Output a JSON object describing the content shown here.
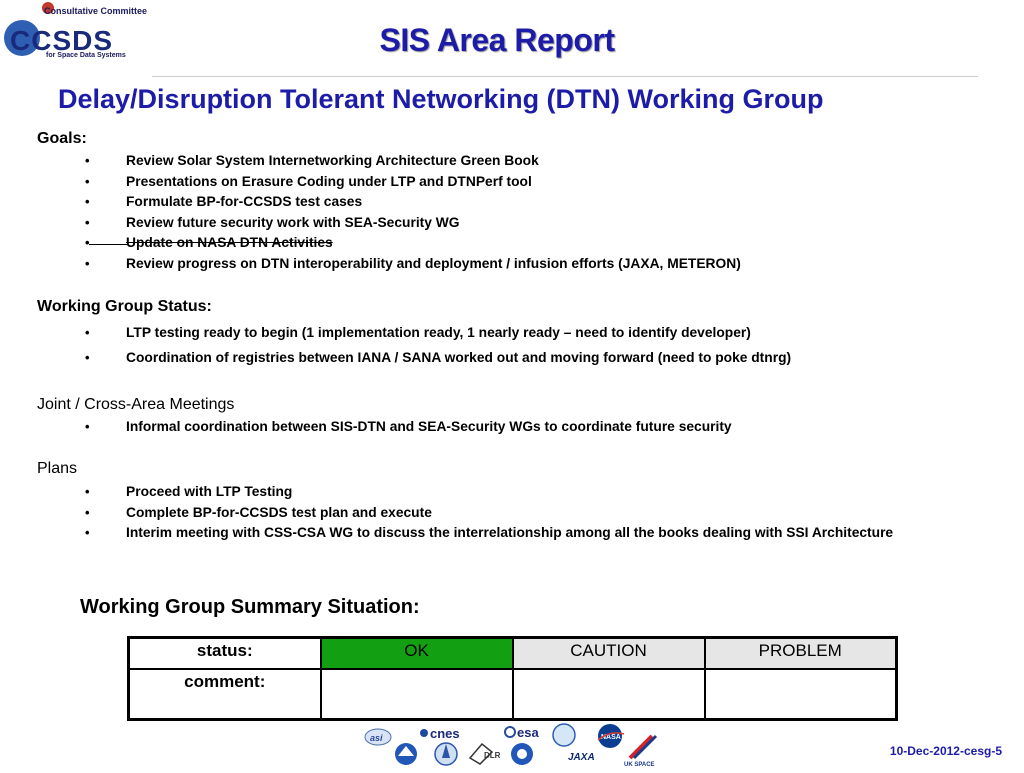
{
  "logo": {
    "line1": "Consultative Committee",
    "wordmark": "CCSDS",
    "line2": "for Space Data Systems"
  },
  "header": {
    "title": "SIS Area Report",
    "subtitle": "Delay/Disruption Tolerant Networking (DTN) Working Group"
  },
  "goals": {
    "heading": "Goals:",
    "items": [
      {
        "text": "Review Solar System Internetworking Architecture Green Book",
        "strike": false
      },
      {
        "text": "Presentations on Erasure Coding under LTP and DTNPerf tool",
        "strike": false
      },
      {
        "text": "Formulate BP-for-CCSDS test cases",
        "strike": false
      },
      {
        "text": "Review future security work with SEA-Security WG",
        "strike": false
      },
      {
        "text": "Update on NASA DTN Activities",
        "strike": true
      },
      {
        "text": "Review progress on DTN interoperability and deployment / infusion efforts (JAXA, METERON)",
        "strike": false
      }
    ]
  },
  "status_section": {
    "heading": "Working Group Status:",
    "items": [
      {
        "text": "LTP testing ready to begin (1 implementation ready, 1 nearly ready – need to identify developer)"
      },
      {
        "text": "Coordination of registries between IANA / SANA worked out and moving forward (need to poke dtnrg)"
      }
    ]
  },
  "joint": {
    "heading": "Joint / Cross-Area Meetings",
    "items": [
      {
        "text": "Informal coordination between SIS-DTN and SEA-Security WGs to coordinate future security"
      }
    ]
  },
  "plans": {
    "heading": "Plans",
    "items": [
      {
        "text": "Proceed with LTP Testing"
      },
      {
        "text": "Complete BP-for-CCSDS test plan and execute"
      },
      {
        "text": "Interim meeting with CSS-CSA WG to discuss the interrelationship among all the books dealing with SSI Architecture"
      }
    ]
  },
  "summary": {
    "title": "Working Group Summary Situation:",
    "status_label": "status:",
    "ok": "OK",
    "caution": "CAUTION",
    "problem": "PROBLEM",
    "comment_label": "comment:",
    "ok_color": "#12a012"
  },
  "footer": {
    "agencies": [
      "ASI",
      "CNES",
      "CSA",
      "DLR",
      "ESA",
      "INPE",
      "JAXA",
      "NASA",
      "UK SPACE"
    ],
    "uk_space_label": "UK SPACE",
    "jaxa_label": "JAXA",
    "dlr_label": "DLR",
    "date_code": "10-Dec-2012-cesg-5"
  },
  "bullet_char": "•"
}
